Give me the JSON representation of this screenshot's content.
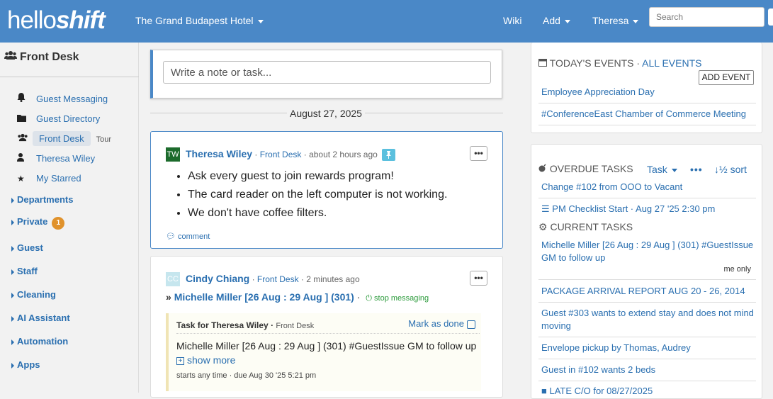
{
  "nav": {
    "logo_light": "hello",
    "logo_bold": "shift",
    "hotel": "The Grand Budapest Hotel",
    "wiki": "Wiki",
    "add": "Add",
    "user": "Theresa",
    "search_placeholder": "Search"
  },
  "sidebar": {
    "title": "Front Desk",
    "items": [
      {
        "icon": "bell-icon",
        "label": "Guest Messaging"
      },
      {
        "icon": "folder-icon",
        "label": "Guest Directory"
      },
      {
        "icon": "users-icon",
        "label": "Front Desk",
        "extra": "Tour"
      },
      {
        "icon": "user-icon",
        "label": "Theresa Wiley"
      },
      {
        "icon": "star-icon",
        "label": "My Starred"
      }
    ],
    "groups": [
      {
        "label": "Departments"
      },
      {
        "label": "Private",
        "badge": "1"
      },
      {
        "label": "Guest"
      },
      {
        "label": "Staff"
      },
      {
        "label": "Cleaning"
      },
      {
        "label": "AI Assistant"
      },
      {
        "label": "Automation"
      },
      {
        "label": "Apps"
      }
    ]
  },
  "feed": {
    "note_placeholder": "Write a note or task...",
    "date": "August 27, 2025",
    "post1": {
      "initials": "TW",
      "author": "Theresa Wiley",
      "location": "Front Desk",
      "time": "about 2 hours ago",
      "bullets": [
        "Ask every guest to join rewards program!",
        "The card reader on the left computer is not working.",
        "We don't have coffee filters."
      ],
      "comment": "comment"
    },
    "post2": {
      "initials": "CC",
      "author": "Cindy Chiang",
      "location": "Front Desk",
      "time": "2 minutes ago",
      "guest": "Michelle Miller [26 Aug : 29 Aug ] (301)",
      "stop": "stop messaging",
      "task_title": "Task for Theresa Wiley",
      "task_loc": "Front Desk",
      "mark_done": "Mark as done",
      "task_body": "Michelle Miller [26 Aug : 29 Aug ] (301) #GuestIssue GM to follow up",
      "show_more": "show more",
      "task_meta": "starts any time · due Aug 30 '25 5:21 pm"
    }
  },
  "events": {
    "title": "TODAY'S EVENTS",
    "all": "ALL EVENTS",
    "add": "ADD EVENT",
    "items": [
      "Employee Appreciation Day",
      "#ConferenceEast Chamber of Commerce Meeting"
    ]
  },
  "tasks": {
    "overdue_title": "OVERDUE TASKS",
    "filter": "Task",
    "sort": "sort",
    "overdue": [
      "Change #102 from OOO to Vacant",
      "PM Checklist Start · Aug 27 '25 2:30 pm"
    ],
    "current_title": "CURRENT TASKS",
    "current": [
      "Michelle Miller [26 Aug : 29 Aug ] (301) #GuestIssue GM to follow up",
      "PACKAGE ARRIVAL REPORT AUG 20 - 26, 2014",
      "Guest #303 wants to extend stay and does not mind moving",
      "Envelope pickup by Thomas, Audrey",
      "Guest in #102 wants 2 beds",
      "LATE C/O for 08/27/2025"
    ],
    "me_only": "me only"
  },
  "colors": {
    "nav": "#4a88c7",
    "link": "#2a6fb0",
    "badge": "#e0922c",
    "stop": "#2a9a3a"
  }
}
